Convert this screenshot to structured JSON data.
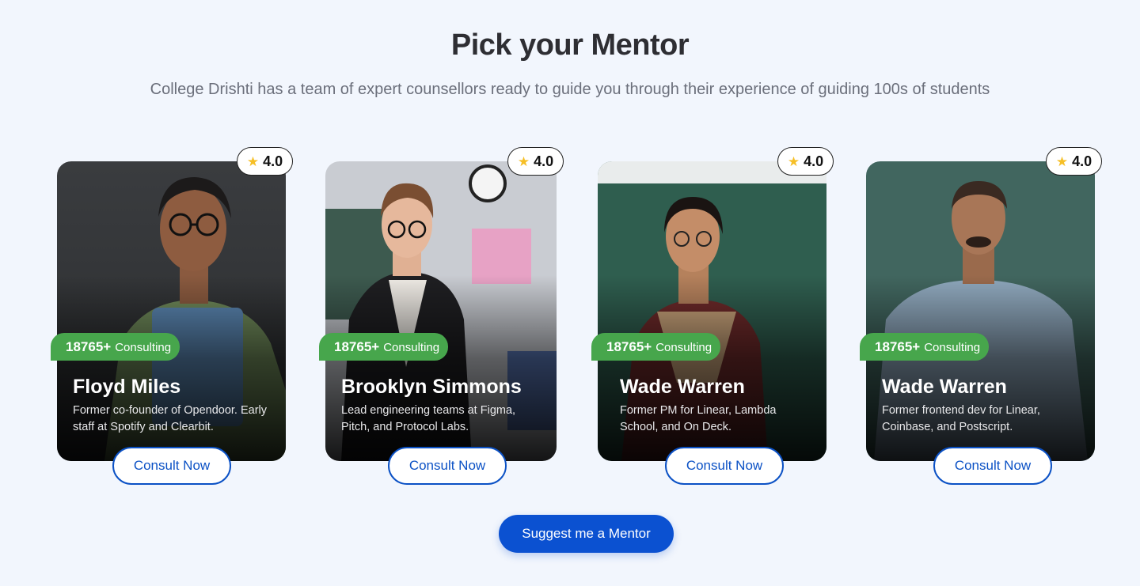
{
  "header": {
    "title": "Pick your Mentor",
    "subtitle": "College Drishti has a team of expert counsellors ready to guide you through their experience of guiding 100s of students"
  },
  "mentors": [
    {
      "name": "Floyd Miles",
      "description": "Former co-founder of Opendoor. Early staff at Spotify and Clearbit.",
      "rating": "4.0",
      "consult_count": "18765+",
      "consult_label": "Consulting",
      "button_label": "Consult Now"
    },
    {
      "name": "Brooklyn Simmons",
      "description": "Lead engineering teams at Figma, Pitch, and Protocol Labs.",
      "rating": "4.0",
      "consult_count": "18765+",
      "consult_label": "Consulting",
      "button_label": "Consult Now"
    },
    {
      "name": "Wade Warren",
      "description": "Former PM for Linear, Lambda School, and On Deck.",
      "rating": "4.0",
      "consult_count": "18765+",
      "consult_label": "Consulting",
      "button_label": "Consult Now"
    },
    {
      "name": "Wade Warren",
      "description": "Former frontend dev for Linear, Coinbase, and Postscript.",
      "rating": "4.0",
      "consult_count": "18765+",
      "consult_label": "Consulting",
      "button_label": "Consult Now"
    }
  ],
  "suggest_button": "Suggest me a Mentor",
  "icons": {
    "rating": "star-icon"
  },
  "colors": {
    "primary": "#0b51d1",
    "consult_badge": "#47a64c",
    "star": "#f6bf26",
    "background": "#f2f6fd"
  }
}
